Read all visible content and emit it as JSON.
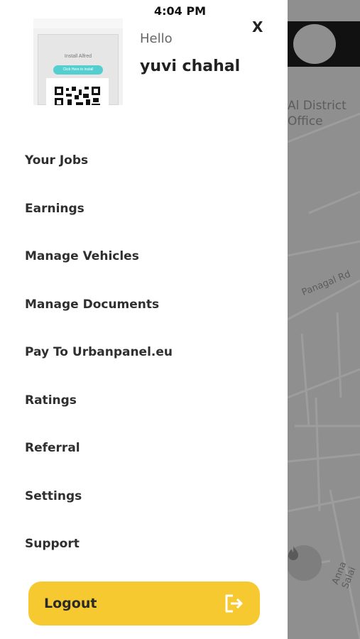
{
  "status_bar": {
    "time": "4:04 PM"
  },
  "map": {
    "labels": {
      "district": "Al District\nOffice",
      "road1": "Panagal Rd",
      "road2": "Anna Salai"
    },
    "fab_icon": "flame-icon"
  },
  "drawer": {
    "close_label": "X",
    "profile": {
      "greeting": "Hello",
      "name": "yuvi chahal",
      "avatar_text": {
        "install": "Install Alfred",
        "click": "Click Here to install"
      }
    },
    "menu": [
      {
        "label": "Your Jobs"
      },
      {
        "label": "Earnings"
      },
      {
        "label": "Manage Vehicles"
      },
      {
        "label": "Manage Documents"
      },
      {
        "label": "Pay To Urbanpanel.eu"
      },
      {
        "label": "Ratings"
      },
      {
        "label": "Referral"
      },
      {
        "label": "Settings"
      },
      {
        "label": "Support"
      }
    ],
    "logout": {
      "label": "Logout",
      "icon": "logout-icon"
    }
  },
  "colors": {
    "accent": "#f6c930",
    "map_overlay": "#8f8f8f",
    "avatar_button": "#54cfd0"
  }
}
